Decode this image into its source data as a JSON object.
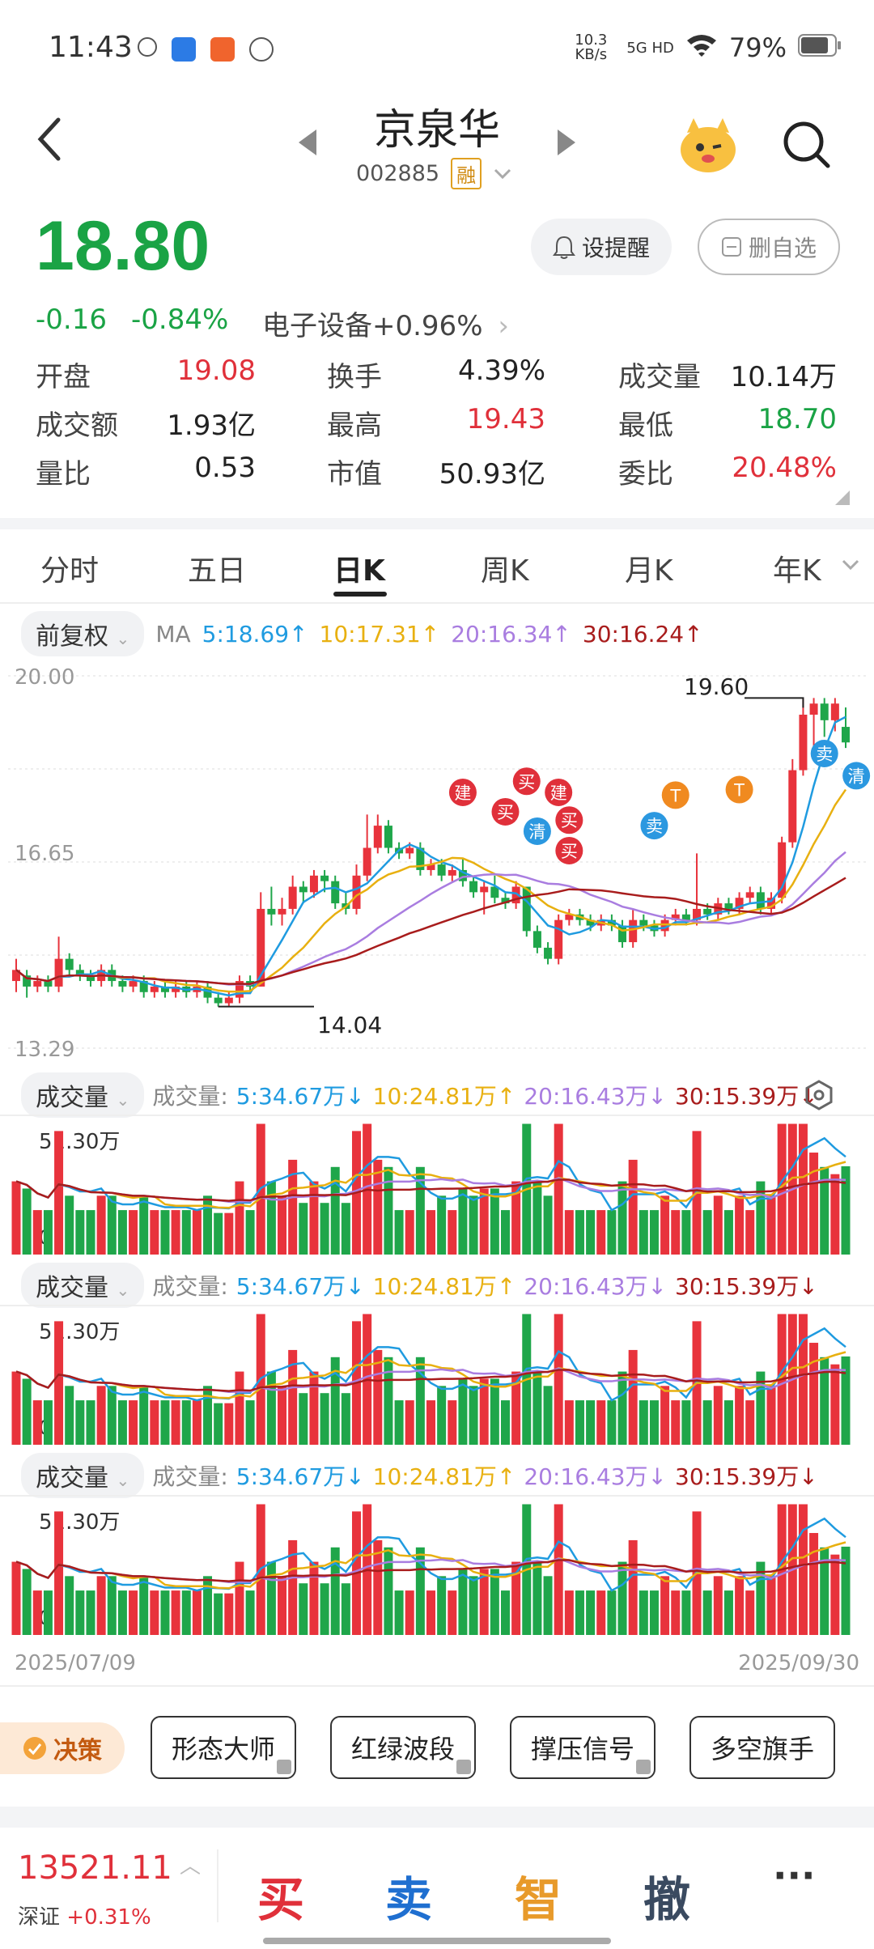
{
  "status": {
    "time": "11:43",
    "net_speed": "10.3 KB/s",
    "network": "5G HD",
    "battery": "79%"
  },
  "header": {
    "stock_name": "京泉华",
    "stock_code": "002885",
    "margin_tag": "融"
  },
  "price": {
    "current": "18.80",
    "change": "-0.16",
    "change_pct": "-0.84%",
    "sector": "电子设备",
    "sector_chg": "+0.96%"
  },
  "actions": {
    "alert": "设提醒",
    "unwatch": "删自选"
  },
  "stats": [
    [
      {
        "label": "开盘",
        "value": "19.08",
        "color": "red"
      },
      {
        "label": "换手",
        "value": "4.39%",
        "color": "dark"
      },
      {
        "label": "成交量",
        "value": "10.14万",
        "color": "dark"
      }
    ],
    [
      {
        "label": "成交额",
        "value": "1.93亿",
        "color": "dark"
      },
      {
        "label": "最高",
        "value": "19.43",
        "color": "red"
      },
      {
        "label": "最低",
        "value": "18.70",
        "color": "green"
      }
    ],
    [
      {
        "label": "量比",
        "value": "0.53",
        "color": "dark"
      },
      {
        "label": "市值",
        "value": "50.93亿",
        "color": "dark"
      },
      {
        "label": "委比",
        "value": "20.48%",
        "color": "red"
      }
    ]
  ],
  "tabs": [
    "分时",
    "五日",
    "日K",
    "周K",
    "月K",
    "年K"
  ],
  "ma_bar": {
    "adjust": "前复权",
    "ma_label": "MA",
    "ma5": "5:18.69↑",
    "ma10": "10:17.31↑",
    "ma20": "20:16.34↑",
    "ma30": "30:16.24↑"
  },
  "kline_axis": {
    "top": "20.00",
    "mid": "16.65",
    "bottom": "13.29",
    "high_label": "19.60",
    "low_label": "14.04"
  },
  "vol_panels": [
    {
      "dropdown": "成交量",
      "prefix": "成交量:",
      "v5": "5:34.67万↓",
      "v10": "10:24.81万↑",
      "v20": "20:16.43万↓",
      "v30": "30:15.39万↓",
      "max": "51.30万",
      "zero": "0"
    },
    {
      "dropdown": "成交量",
      "prefix": "成交量:",
      "v5": "5:34.67万↓",
      "v10": "10:24.81万↑",
      "v20": "20:16.43万↓",
      "v30": "30:15.39万↓",
      "max": "51.30万",
      "zero": "0"
    },
    {
      "dropdown": "成交量",
      "prefix": "成交量:",
      "v5": "5:34.67万↓",
      "v10": "10:24.81万↑",
      "v20": "20:16.43万↓",
      "v30": "30:15.39万↓",
      "max": "51.30万",
      "zero": "0"
    }
  ],
  "dates": {
    "start": "2025/07/09",
    "end": "2025/09/30"
  },
  "tools": {
    "decision": "决策",
    "t1": "形态大师",
    "t2": "红绿波段",
    "t3": "撑压信号",
    "t4": "多空旗手"
  },
  "footer": {
    "index_value": "13521.11",
    "index_name": "深证",
    "index_chg": "+0.31%",
    "buy": "买",
    "sell": "卖",
    "smart": "智",
    "cancel": "撤",
    "more": "···"
  },
  "signals": [
    "建",
    "买",
    "买",
    "建",
    "清",
    "买",
    "买",
    "卖",
    "T",
    "T",
    "卖",
    "清"
  ],
  "chart_data": {
    "type": "candlestick",
    "title": "",
    "y_range": [
      13.29,
      20.0
    ],
    "x_range": [
      "2025/07/09",
      "2025/09/30"
    ],
    "candles": [
      [
        14.5,
        14.7,
        14.3,
        14.9
      ],
      [
        14.6,
        14.4,
        14.2,
        14.7
      ],
      [
        14.4,
        14.5,
        14.3,
        14.6
      ],
      [
        14.5,
        14.4,
        14.3,
        14.6
      ],
      [
        14.4,
        14.9,
        14.3,
        15.3
      ],
      [
        14.9,
        14.7,
        14.6,
        15.0
      ],
      [
        14.7,
        14.6,
        14.5,
        14.8
      ],
      [
        14.6,
        14.5,
        14.4,
        14.7
      ],
      [
        14.5,
        14.7,
        14.4,
        14.8
      ],
      [
        14.7,
        14.5,
        14.4,
        14.8
      ],
      [
        14.5,
        14.4,
        14.3,
        14.6
      ],
      [
        14.4,
        14.5,
        14.3,
        14.6
      ],
      [
        14.5,
        14.3,
        14.2,
        14.6
      ],
      [
        14.3,
        14.4,
        14.2,
        14.5
      ],
      [
        14.4,
        14.3,
        14.2,
        14.5
      ],
      [
        14.3,
        14.4,
        14.2,
        14.5
      ],
      [
        14.4,
        14.3,
        14.2,
        14.5
      ],
      [
        14.3,
        14.4,
        14.2,
        14.5
      ],
      [
        14.4,
        14.2,
        14.1,
        14.5
      ],
      [
        14.2,
        14.1,
        14.04,
        14.3
      ],
      [
        14.1,
        14.2,
        14.04,
        14.3
      ],
      [
        14.2,
        14.5,
        14.1,
        14.6
      ],
      [
        14.5,
        14.4,
        14.3,
        14.6
      ],
      [
        14.4,
        15.8,
        14.4,
        16.1
      ],
      [
        15.8,
        15.7,
        15.5,
        16.2
      ],
      [
        15.7,
        15.8,
        15.5,
        16.0
      ],
      [
        15.8,
        16.2,
        15.7,
        16.4
      ],
      [
        16.2,
        16.1,
        15.9,
        16.3
      ],
      [
        16.1,
        16.4,
        16.0,
        16.5
      ],
      [
        16.4,
        16.3,
        16.1,
        16.5
      ],
      [
        16.3,
        15.9,
        15.8,
        16.4
      ],
      [
        15.9,
        15.8,
        15.7,
        16.1
      ],
      [
        15.8,
        16.4,
        15.7,
        16.6
      ],
      [
        16.4,
        16.9,
        16.3,
        17.5
      ],
      [
        16.9,
        17.3,
        16.8,
        17.5
      ],
      [
        17.3,
        16.9,
        16.8,
        17.4
      ],
      [
        16.9,
        16.8,
        16.7,
        17.0
      ],
      [
        16.8,
        16.9,
        16.7,
        17.0
      ],
      [
        16.9,
        16.5,
        16.4,
        17.0
      ],
      [
        16.5,
        16.6,
        16.4,
        16.7
      ],
      [
        16.6,
        16.4,
        16.3,
        16.7
      ],
      [
        16.4,
        16.5,
        16.3,
        16.6
      ],
      [
        16.5,
        16.3,
        16.2,
        16.7
      ],
      [
        16.3,
        16.1,
        16.0,
        16.4
      ],
      [
        16.1,
        16.2,
        15.7,
        16.3
      ],
      [
        16.2,
        16.0,
        15.9,
        16.4
      ],
      [
        16.0,
        15.9,
        15.8,
        16.1
      ],
      [
        15.9,
        16.2,
        15.8,
        16.3
      ],
      [
        16.2,
        15.4,
        15.3,
        16.2
      ],
      [
        15.4,
        15.1,
        15.0,
        15.5
      ],
      [
        15.1,
        14.9,
        14.8,
        15.2
      ],
      [
        14.9,
        15.6,
        14.8,
        15.7
      ],
      [
        15.6,
        15.7,
        15.5,
        15.8
      ],
      [
        15.7,
        15.6,
        15.5,
        15.8
      ],
      [
        15.6,
        15.5,
        15.4,
        15.7
      ],
      [
        15.5,
        15.6,
        15.4,
        15.7
      ],
      [
        15.6,
        15.5,
        15.4,
        15.7
      ],
      [
        15.5,
        15.2,
        15.1,
        15.6
      ],
      [
        15.2,
        15.6,
        15.1,
        15.8
      ],
      [
        15.6,
        15.5,
        15.4,
        15.7
      ],
      [
        15.5,
        15.4,
        15.3,
        15.6
      ],
      [
        15.4,
        15.6,
        15.3,
        15.7
      ],
      [
        15.6,
        15.7,
        15.5,
        15.8
      ],
      [
        15.7,
        15.6,
        15.5,
        15.8
      ],
      [
        15.6,
        15.8,
        15.5,
        16.8
      ],
      [
        15.8,
        15.7,
        15.6,
        15.9
      ],
      [
        15.7,
        15.9,
        15.6,
        16.0
      ],
      [
        15.9,
        15.8,
        15.7,
        16.0
      ],
      [
        15.8,
        16.0,
        15.7,
        16.1
      ],
      [
        16.0,
        16.1,
        15.9,
        16.2
      ],
      [
        16.1,
        15.8,
        15.7,
        16.2
      ],
      [
        15.8,
        16.0,
        15.7,
        16.1
      ],
      [
        16.0,
        17.0,
        15.9,
        17.1
      ],
      [
        17.0,
        18.3,
        16.9,
        18.5
      ],
      [
        18.3,
        19.3,
        18.2,
        19.6
      ],
      [
        19.3,
        19.5,
        18.6,
        19.6
      ],
      [
        19.5,
        19.2,
        18.9,
        19.6
      ],
      [
        19.2,
        19.5,
        19.0,
        19.6
      ],
      [
        19.08,
        18.8,
        18.7,
        19.43
      ]
    ],
    "volume_max": "51.30万"
  }
}
